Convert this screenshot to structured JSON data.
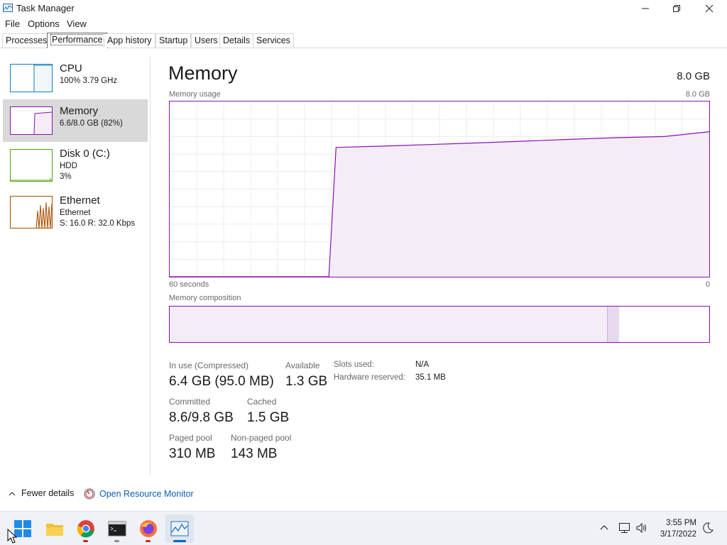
{
  "window": {
    "title": "Task Manager"
  },
  "menu": [
    "File",
    "Options",
    "View"
  ],
  "tabs": [
    {
      "label": "Processes"
    },
    {
      "label": "Performance"
    },
    {
      "label": "App history"
    },
    {
      "label": "Startup"
    },
    {
      "label": "Users"
    },
    {
      "label": "Details"
    },
    {
      "label": "Services"
    }
  ],
  "sidebar": [
    {
      "name": "CPU",
      "line1": "100% 3.79 GHz",
      "line2": ""
    },
    {
      "name": "Memory",
      "line1": "6.6/8.0 GB (82%)",
      "line2": ""
    },
    {
      "name": "Disk 0 (C:)",
      "line1": "HDD",
      "line2": "3%"
    },
    {
      "name": "Ethernet",
      "line1": "Ethernet",
      "line2": "S: 16.0 R: 32.0 Kbps"
    }
  ],
  "main": {
    "title": "Memory",
    "capacity": "8.0 GB",
    "usage_label": "Memory usage",
    "usage_max": "8.0 GB",
    "time_left": "60 seconds",
    "time_right": "0",
    "composition_label": "Memory composition",
    "composition": {
      "in_use_fraction": 0.81,
      "modified_fraction": 0.023
    }
  },
  "stats": {
    "in_use_label": "In use (Compressed)",
    "in_use_value": "6.4 GB (95.0 MB)",
    "available_label": "Available",
    "available_value": "1.3 GB",
    "committed_label": "Committed",
    "committed_value": "8.6/9.8 GB",
    "cached_label": "Cached",
    "cached_value": "1.5 GB",
    "paged_label": "Paged pool",
    "paged_value": "310 MB",
    "nonpaged_label": "Non-paged pool",
    "nonpaged_value": "143 MB",
    "slots_label": "Slots used:",
    "slots_value": "N/A",
    "hw_label": "Hardware reserved:",
    "hw_value": "35.1 MB"
  },
  "footer": {
    "fewer": "Fewer details",
    "resource_monitor": "Open Resource Monitor"
  },
  "taskbar": {
    "apps": [
      "start-icon",
      "file-explorer-icon",
      "chrome-icon",
      "terminal-icon",
      "firefox-icon",
      "task-manager-icon"
    ],
    "time": "3:55 PM",
    "date": "3/17/2022"
  },
  "colors": {
    "memory": "#8b12ae",
    "cpu": "#117dbb",
    "disk": "#4da60c",
    "ethernet": "#a74f01",
    "accent": "#0b5fb8"
  },
  "chart_data": {
    "type": "area",
    "title": "Memory usage",
    "xlabel": "60 seconds",
    "ylabel": "",
    "x": [
      60,
      42.3,
      41.5,
      40,
      35,
      30,
      25,
      20,
      15,
      10,
      5,
      0
    ],
    "y": [
      0,
      0,
      5.9,
      5.92,
      5.98,
      6.05,
      6.12,
      6.2,
      6.28,
      6.35,
      6.4,
      6.62
    ],
    "xlim": [
      60,
      0
    ],
    "ylim": [
      0,
      8.0
    ],
    "grid": true
  }
}
